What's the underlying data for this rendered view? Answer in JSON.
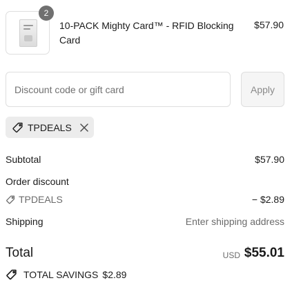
{
  "product": {
    "thumbnail_icon": "rfid-card-thumbnail",
    "quantity": "2",
    "title": "10-PACK Mighty Card™ - RFID Blocking Card",
    "price": "$57.90"
  },
  "discount_form": {
    "placeholder": "Discount code or gift card",
    "value": "",
    "apply_label": "Apply"
  },
  "applied_code": {
    "icon": "tag-icon",
    "label": "TPDEALS",
    "remove_icon": "close-icon"
  },
  "summary": {
    "subtotal_label": "Subtotal",
    "subtotal_value": "$57.90",
    "order_discount_label": "Order discount",
    "discount_code": "TPDEALS",
    "discount_value": "− $2.89",
    "shipping_label": "Shipping",
    "shipping_value": "Enter shipping address"
  },
  "total": {
    "label": "Total",
    "currency": "USD",
    "value": "$55.01"
  },
  "savings": {
    "icon": "savings-tag-icon",
    "label": "TOTAL SAVINGS",
    "value": "$2.89"
  },
  "colors": {
    "text": "#1a1a1a",
    "muted": "#6b6b6b",
    "border": "#dedede",
    "chip_bg": "#ececec",
    "badge_bg": "#707070"
  }
}
